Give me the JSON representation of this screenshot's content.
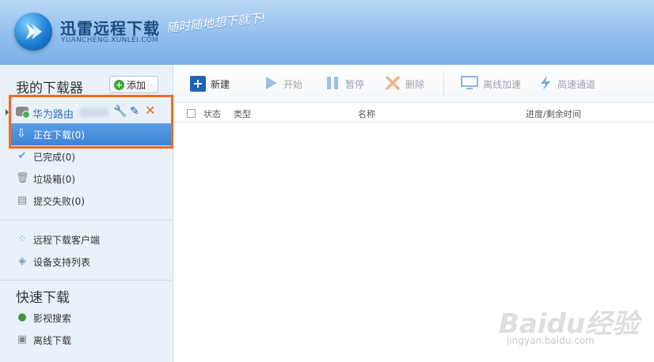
{
  "header": {
    "title": "迅雷远程下载",
    "subtitle": "YUANCHENG.XUNLEI.COM",
    "slogan": "随时随地想下就下!"
  },
  "sidebar": {
    "title": "我的下载器",
    "add_label": "添加",
    "device": {
      "name": "华为路由"
    },
    "downloading_label": "正在下载(0)",
    "items": [
      {
        "label": "已完成(0)",
        "icon": "check-icon"
      },
      {
        "label": "垃圾箱(0)",
        "icon": "trash-icon"
      },
      {
        "label": "提交失败(0)",
        "icon": "document-icon"
      }
    ],
    "tools": [
      {
        "label": "远程下载客户端",
        "icon": "client-icon"
      },
      {
        "label": "设备支持列表",
        "icon": "layers-icon"
      }
    ],
    "quick_title": "快速下载",
    "quick_items": [
      {
        "label": "影视搜索",
        "icon": "globe-icon"
      },
      {
        "label": "离线下载",
        "icon": "monitor-icon"
      }
    ]
  },
  "toolbar": {
    "new_label": "新建",
    "start_label": "开始",
    "pause_label": "暂停",
    "delete_label": "删除",
    "offline_label": "离线加速",
    "fast_label": "高速通道"
  },
  "table": {
    "col_status": "状态",
    "col_type": "类型",
    "col_name": "名称",
    "col_progress": "进度/剩余时间"
  },
  "watermark": {
    "brand": "Baidu经验",
    "url": "jingyan.baidu.com"
  },
  "colors": {
    "accent": "#3d84d6",
    "highlight": "#f26b21",
    "header_blue": "#8fbdee"
  }
}
